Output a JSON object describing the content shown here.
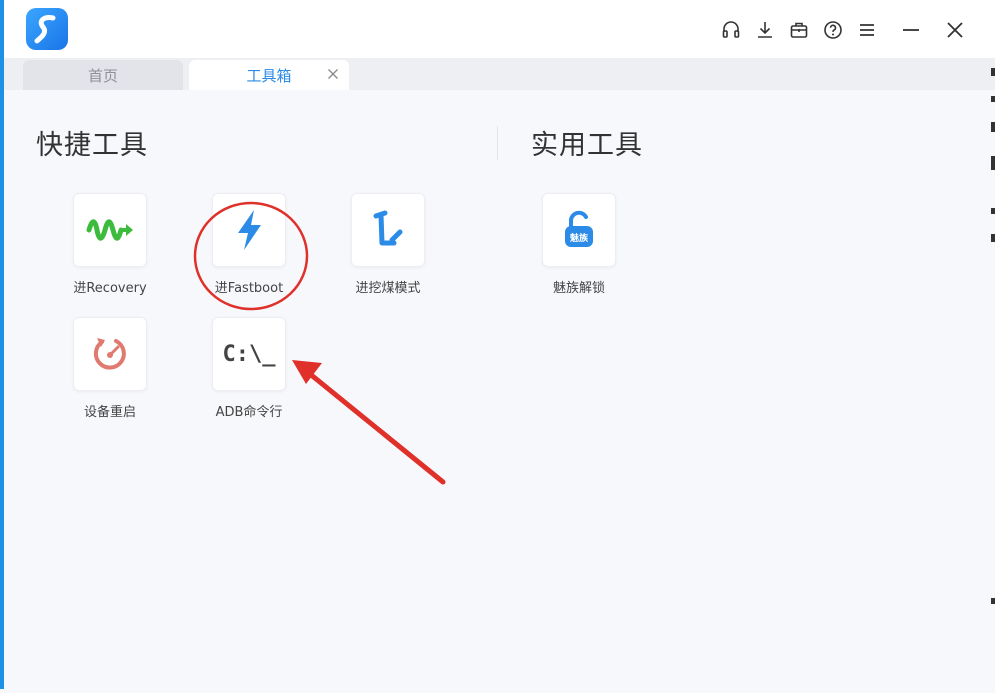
{
  "tabs": [
    {
      "label": "首页",
      "active": false
    },
    {
      "label": "工具箱",
      "active": true
    }
  ],
  "titlebar_icons": [
    "headset-icon",
    "download-icon",
    "briefcase-icon",
    "help-icon",
    "menu-icon",
    "minimize-icon",
    "close-icon"
  ],
  "sections": {
    "quick": {
      "title": "快捷工具",
      "tools": [
        {
          "label": "进Recovery",
          "icon": "recovery-wave-icon"
        },
        {
          "label": "进Fastboot",
          "icon": "lightning-icon"
        },
        {
          "label": "进挖煤模式",
          "icon": "pickaxe-icon"
        },
        {
          "label": "设备重启",
          "icon": "restart-icon"
        },
        {
          "label": "ADB命令行",
          "icon": "terminal-icon",
          "icon_text": "C:\\_"
        }
      ]
    },
    "utility": {
      "title": "实用工具",
      "tools": [
        {
          "label": "魅族解锁",
          "icon": "unlock-icon",
          "icon_text": "魅族"
        }
      ]
    }
  },
  "colors": {
    "accent": "#2b8be6",
    "annotation_red": "#e0302a",
    "recovery_green": "#3dbb3d",
    "restart_red": "#e07a6e"
  }
}
